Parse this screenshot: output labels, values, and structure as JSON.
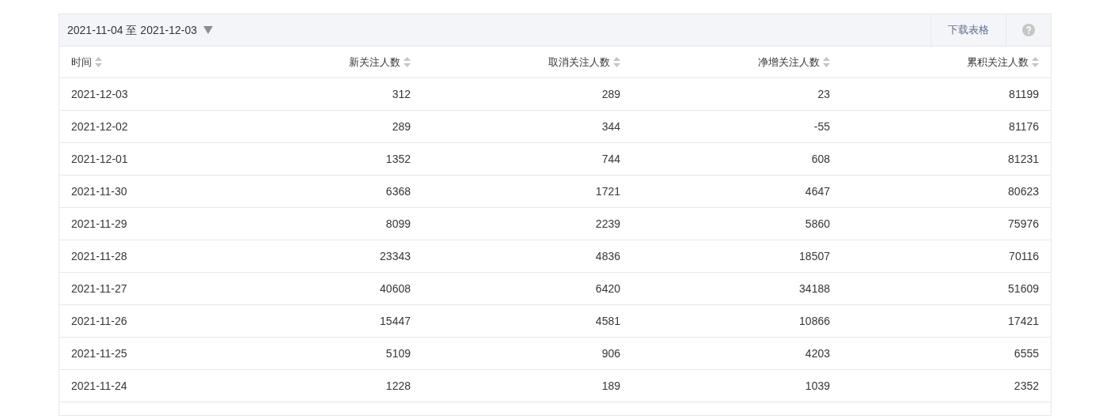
{
  "toolbar": {
    "date_range": "2021-11-04 至 2021-12-03",
    "download_button": "下载表格"
  },
  "table": {
    "columns": [
      "时间",
      "新关注人数",
      "取消关注人数",
      "净增关注人数",
      "累积关注人数"
    ],
    "rows": [
      [
        "2021-12-03",
        "312",
        "289",
        "23",
        "81199"
      ],
      [
        "2021-12-02",
        "289",
        "344",
        "-55",
        "81176"
      ],
      [
        "2021-12-01",
        "1352",
        "744",
        "608",
        "81231"
      ],
      [
        "2021-11-30",
        "6368",
        "1721",
        "4647",
        "80623"
      ],
      [
        "2021-11-29",
        "8099",
        "2239",
        "5860",
        "75976"
      ],
      [
        "2021-11-28",
        "23343",
        "4836",
        "18507",
        "70116"
      ],
      [
        "2021-11-27",
        "40608",
        "6420",
        "34188",
        "51609"
      ],
      [
        "2021-11-26",
        "15447",
        "4581",
        "10866",
        "17421"
      ],
      [
        "2021-11-25",
        "5109",
        "906",
        "4203",
        "6555"
      ],
      [
        "2021-11-24",
        "1228",
        "189",
        "1039",
        "2352"
      ]
    ]
  }
}
